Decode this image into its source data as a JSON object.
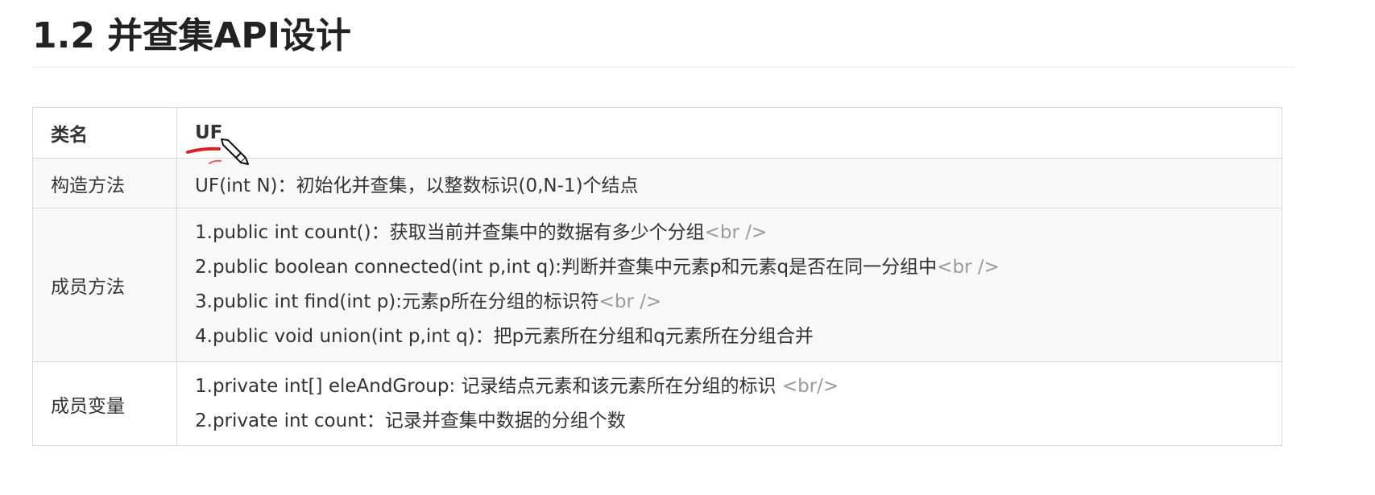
{
  "heading": "1.2 并查集API设计",
  "table": {
    "rows": [
      {
        "label": "类名",
        "value": "UF"
      },
      {
        "label": "构造方法",
        "value": "UF(int N)：初始化并查集，以整数标识(0,N-1)个结点"
      },
      {
        "label": "成员方法",
        "lines": [
          {
            "text": "1.public int count()：获取当前并查集中的数据有多少个分组",
            "tag": "<br />"
          },
          {
            "text": "2.public boolean connected(int p,int q):判断并查集中元素p和元素q是否在同一分组中",
            "tag": "<br />"
          },
          {
            "text": "3.public int find(int p):元素p所在分组的标识符",
            "tag": "<br />"
          },
          {
            "text": "4.public void union(int p,int q)：把p元素所在分组和q元素所在分组合并",
            "tag": ""
          }
        ]
      },
      {
        "label": "成员变量",
        "lines": [
          {
            "text": "1.private int[]  eleAndGroup: 记录结点元素和该元素所在分组的标识 ",
            "tag": "<br/>"
          },
          {
            "text": "2.private int count：记录并查集中数据的分组个数",
            "tag": ""
          }
        ]
      }
    ]
  },
  "colors": {
    "annotation": "#e02020",
    "br_tag": "#9b9b9b"
  },
  "icons": [
    "pen-cursor-icon"
  ]
}
